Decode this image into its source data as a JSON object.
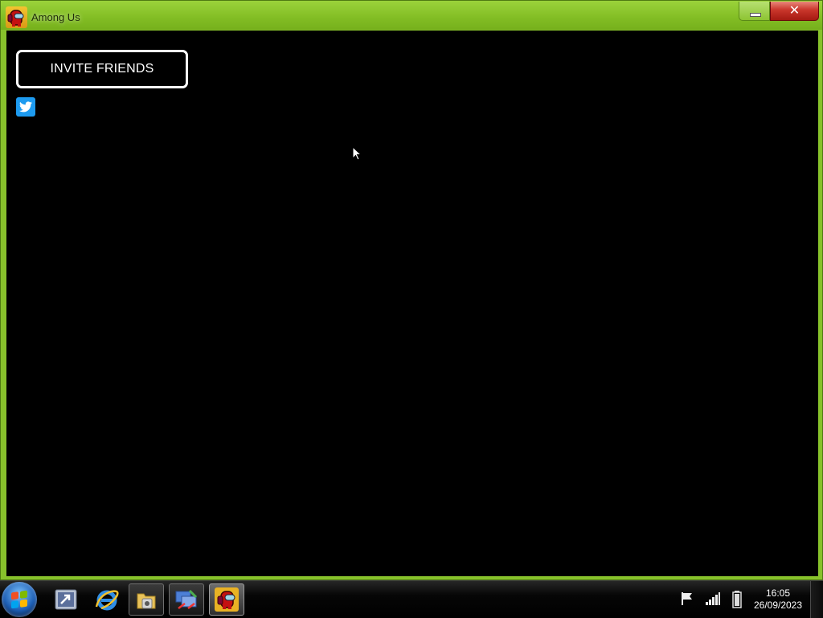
{
  "window": {
    "title": "Among Us",
    "close_glyph": "✕"
  },
  "game": {
    "invite_label": "INVITE FRIENDS",
    "twitter_icon": "twitter-icon"
  },
  "taskbar": {
    "pinned": [
      "remote-desktop-icon",
      "internet-explorer-icon",
      "file-explorer-icon",
      "network-tool-icon",
      "among-us-icon"
    ],
    "tray": [
      "action-center-flag-icon",
      "signal-strength-icon",
      "battery-icon"
    ],
    "clock": {
      "time": "16:05",
      "date": "26/09/2023"
    }
  },
  "colors": {
    "frame": "#87c12b",
    "close": "#c9362b",
    "twitter": "#1d9bf0"
  }
}
